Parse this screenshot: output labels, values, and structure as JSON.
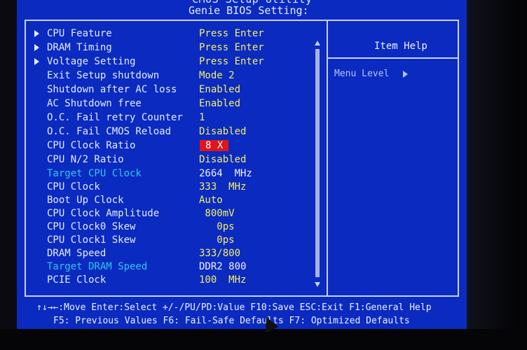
{
  "header": {
    "top_partial": "CMOS Setup Utility",
    "title": "Genie BIOS Setting:"
  },
  "menu": [
    {
      "label": "CPU Feature",
      "value": "Press Enter",
      "submenu": true,
      "label_color": "white",
      "value_style": "yellow"
    },
    {
      "label": "DRAM Timing",
      "value": "Press Enter",
      "submenu": true,
      "label_color": "white",
      "value_style": "yellow"
    },
    {
      "label": "Voltage Setting",
      "value": "Press Enter",
      "submenu": true,
      "label_color": "white",
      "value_style": "yellow"
    },
    {
      "label": "Exit Setup shutdown",
      "value": "Mode 2",
      "submenu": false,
      "label_color": "white",
      "value_style": "yellow"
    },
    {
      "label": "Shutdown after AC loss",
      "value": "Enabled",
      "submenu": false,
      "label_color": "white",
      "value_style": "yellow"
    },
    {
      "label": "AC Shutdown free",
      "value": "Enabled",
      "submenu": false,
      "label_color": "white",
      "value_style": "yellow"
    },
    {
      "label": "O.C. Fail retry Counter",
      "value": "1",
      "submenu": false,
      "label_color": "white",
      "value_style": "yellow"
    },
    {
      "label": "O.C. Fail CMOS Reload",
      "value": "Disabled",
      "submenu": false,
      "label_color": "white",
      "value_style": "yellow"
    },
    {
      "label": "CPU Clock Ratio",
      "value": "8 X",
      "submenu": false,
      "label_color": "white",
      "value_style": "selected"
    },
    {
      "label": "CPU N/2 Ratio",
      "value": "Disabled",
      "submenu": false,
      "label_color": "white",
      "value_style": "yellow"
    },
    {
      "label": "Target CPU Clock",
      "value": "2664  MHz",
      "submenu": false,
      "label_color": "cyan",
      "value_style": "white"
    },
    {
      "label": "CPU Clock",
      "value": "333  MHz",
      "submenu": false,
      "label_color": "white",
      "value_style": "yellow"
    },
    {
      "label": "Boot Up Clock",
      "value": "Auto",
      "submenu": false,
      "label_color": "white",
      "value_style": "yellow"
    },
    {
      "label": "CPU Clock Amplitude",
      "value": " 800mV",
      "submenu": false,
      "label_color": "white",
      "value_style": "yellow"
    },
    {
      "label": "CPU Clock0 Skew",
      "value": "   0ps",
      "submenu": false,
      "label_color": "white",
      "value_style": "yellow"
    },
    {
      "label": "CPU Clock1 Skew",
      "value": "   0ps",
      "submenu": false,
      "label_color": "white",
      "value_style": "yellow"
    },
    {
      "label": "DRAM Speed",
      "value": "333/800",
      "submenu": false,
      "label_color": "white",
      "value_style": "yellow"
    },
    {
      "label": "Target DRAM Speed",
      "value": "DDR2 800",
      "submenu": false,
      "label_color": "cyan",
      "value_style": "white"
    },
    {
      "label": "PCIE Clock",
      "value": "100  MHz",
      "submenu": false,
      "label_color": "white",
      "value_style": "yellow"
    }
  ],
  "help": {
    "title": "Item Help",
    "menu_level": "Menu Level"
  },
  "footer": {
    "line1": "↑↓→←:Move  Enter:Select  +/-/PU/PD:Value  F10:Save  ESC:Exit  F1:General Help",
    "line2": "F5: Previous Values    F6: Fail-Safe Defaults    F7: Optimized Defaults"
  },
  "colors": {
    "background": "#0a2ac0",
    "label": "#e6ebff",
    "value": "#f4ee66",
    "highlight_label": "#2ec8e8",
    "selected_bg": "#e0151a"
  }
}
